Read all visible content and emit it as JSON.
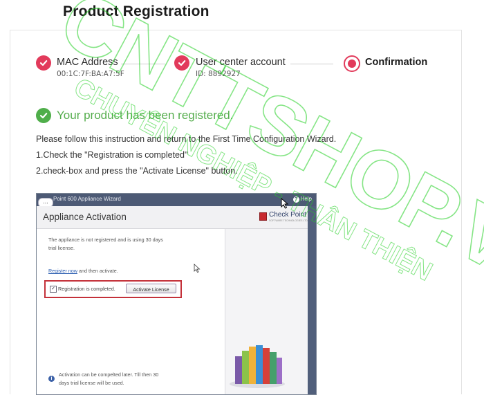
{
  "page": {
    "title": "Product Registration"
  },
  "steps": [
    {
      "title": "MAC Address",
      "subtitle": "00:1C:7F:BA:A7:5F",
      "state": "done"
    },
    {
      "title": "User center account",
      "subtitle": "ID: 8892927",
      "state": "done"
    },
    {
      "title": "Confirmation",
      "subtitle": "",
      "state": "active"
    }
  ],
  "success": {
    "message": "Your product has been registered."
  },
  "instructions": [
    "Please follow this instruction and return to the First Time Configuration Wizard.",
    "1.Check the \"Registration is completed\"",
    "2.check-box and press the \"Activate License\" button."
  ],
  "wizard": {
    "menu_label": "...",
    "window_title": "Point 600 Appliance Wizard",
    "help_label": "Help",
    "heading": "Appliance Activation",
    "brand": "Check Point",
    "brand_tagline": "SOFTWARE TECHNOLOGIES LTD.",
    "status_line1": "The appliance is not registered and is using 30 days",
    "status_line2": "trial license.",
    "register_link": "Register now",
    "register_suffix": " and then activate.",
    "checkbox_label": "Registration is completed.",
    "checkbox_checked": true,
    "activate_button": "Activate License",
    "note_line1": "Activation can be compelted later. Till then 30",
    "note_line2": "days trial license will be used."
  },
  "watermark": {
    "main": "CNTTSHOP.VN",
    "sub": "CHUYÊN NGHIỆP - THÂN THIỆN"
  },
  "colors": {
    "accent": "#e23a5b",
    "success": "#4fae4a",
    "wizard_bar": "#4d5a75",
    "highlight": "#c4313a",
    "watermark": "#22d022"
  }
}
